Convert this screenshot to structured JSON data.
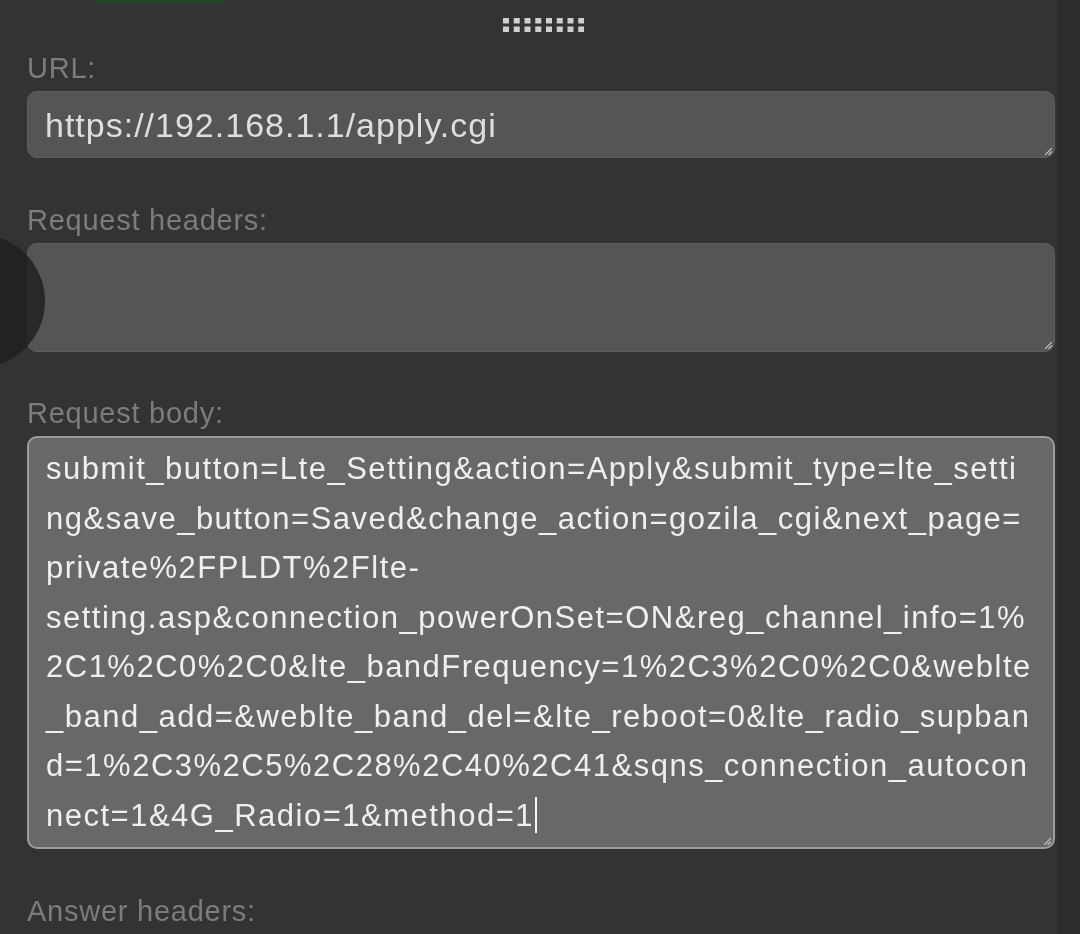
{
  "fields": [
    {
      "label": "URL:",
      "kind": "single",
      "value": "https://192.168.1.1/apply.cgi",
      "focused": false
    },
    {
      "label": "Request headers:",
      "kind": "multi",
      "focused": false
    },
    {
      "label": "Request body:",
      "kind": "multi",
      "value": "submit_button=Lte_Setting&action=Apply&submit_type=lte_setting&save_button=Saved&change_action=gozila_cgi&next_page=private%2FPLDT%2Flte-setting.asp&connection_powerOnSet=ON&reg_channel_info=1%2C1%2C0%2C0&lte_bandFrequency=1%2C3%2C0%2C0&weblte_band_add=&weblte_band_del=&lte_reboot=0&lte_radio_supband=1%2C3%2C5%2C28%2C40%2C41&sqns_connection_autoconnect=1&4G_Radio=1&method=1",
      "focused": true
    },
    {
      "label": "Answer headers:",
      "kind": "label"
    }
  ]
}
